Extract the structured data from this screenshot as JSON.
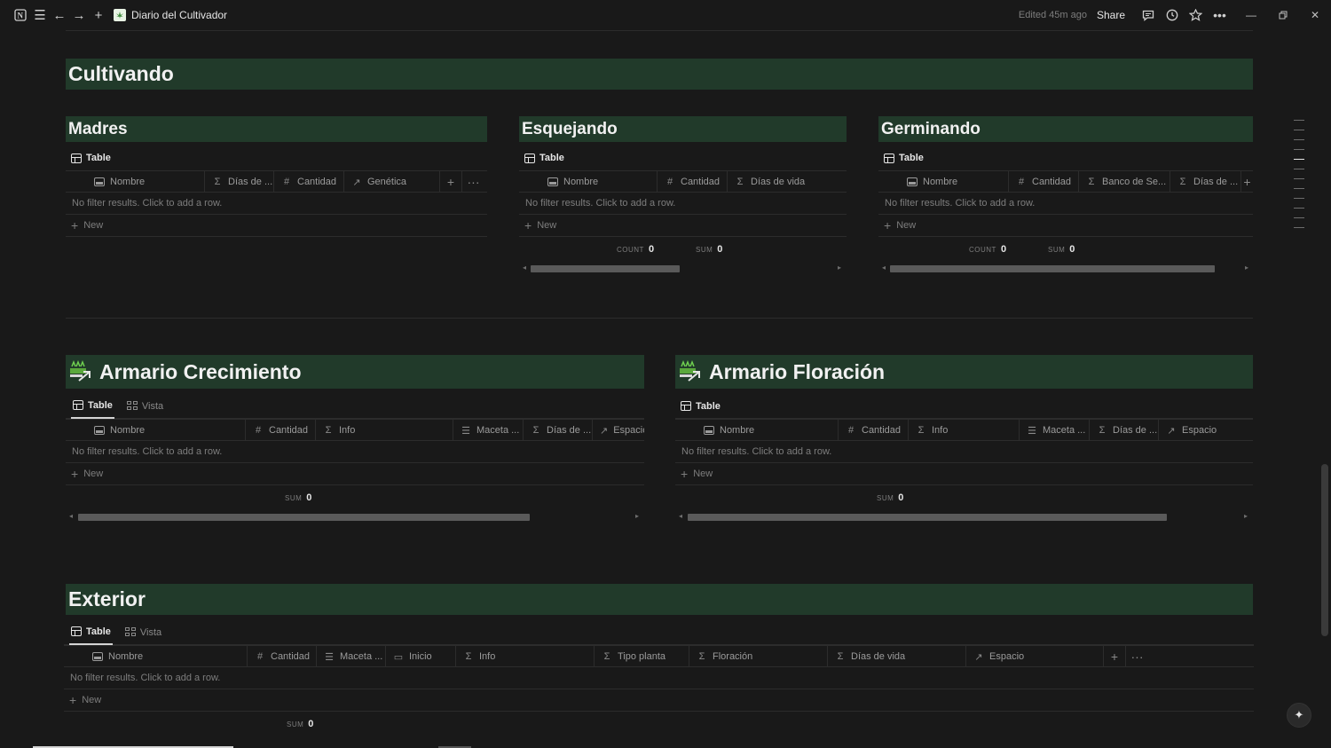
{
  "topbar": {
    "page_title": "Diario del Cultivador",
    "edited": "Edited 45m ago",
    "share": "Share"
  },
  "sections": {
    "cultivando": "Cultivando",
    "exterior": "Exterior"
  },
  "common": {
    "no_filter": "No filter results. Click to add a row.",
    "new": "New",
    "count_label": "COUNT",
    "sum_label": "SUM",
    "zero": "0"
  },
  "madres": {
    "title": "Madres",
    "tab_table": "Table",
    "columns": [
      "Nombre",
      "Días de ...",
      "Cantidad",
      "Genética"
    ]
  },
  "esquejando": {
    "title": "Esquejando",
    "tab_table": "Table",
    "columns": [
      "Nombre",
      "Cantidad",
      "Días de vida"
    ]
  },
  "germinando": {
    "title": "Germinando",
    "tab_table": "Table",
    "columns": [
      "Nombre",
      "Cantidad",
      "Banco de Se...",
      "Días de ..."
    ]
  },
  "crecimiento": {
    "title": "Armario Crecimiento",
    "tab_table": "Table",
    "tab_vista": "Vista",
    "columns": [
      "Nombre",
      "Cantidad",
      "Info",
      "Maceta ...",
      "Días de ...",
      "Espacio"
    ]
  },
  "floracion": {
    "title": "Armario Floración",
    "tab_table": "Table",
    "columns": [
      "Nombre",
      "Cantidad",
      "Info",
      "Maceta ...",
      "Días de ...",
      "Espacio"
    ]
  },
  "exterior_db": {
    "tab_table": "Table",
    "tab_vista": "Vista",
    "columns": [
      "Nombre",
      "Cantidad",
      "Maceta ...",
      "Inicio",
      "Info",
      "Tipo planta",
      "Floración",
      "Días de vida",
      "Espacio"
    ]
  },
  "colors": {
    "heading_band": "#213a2a",
    "background": "#191919"
  }
}
